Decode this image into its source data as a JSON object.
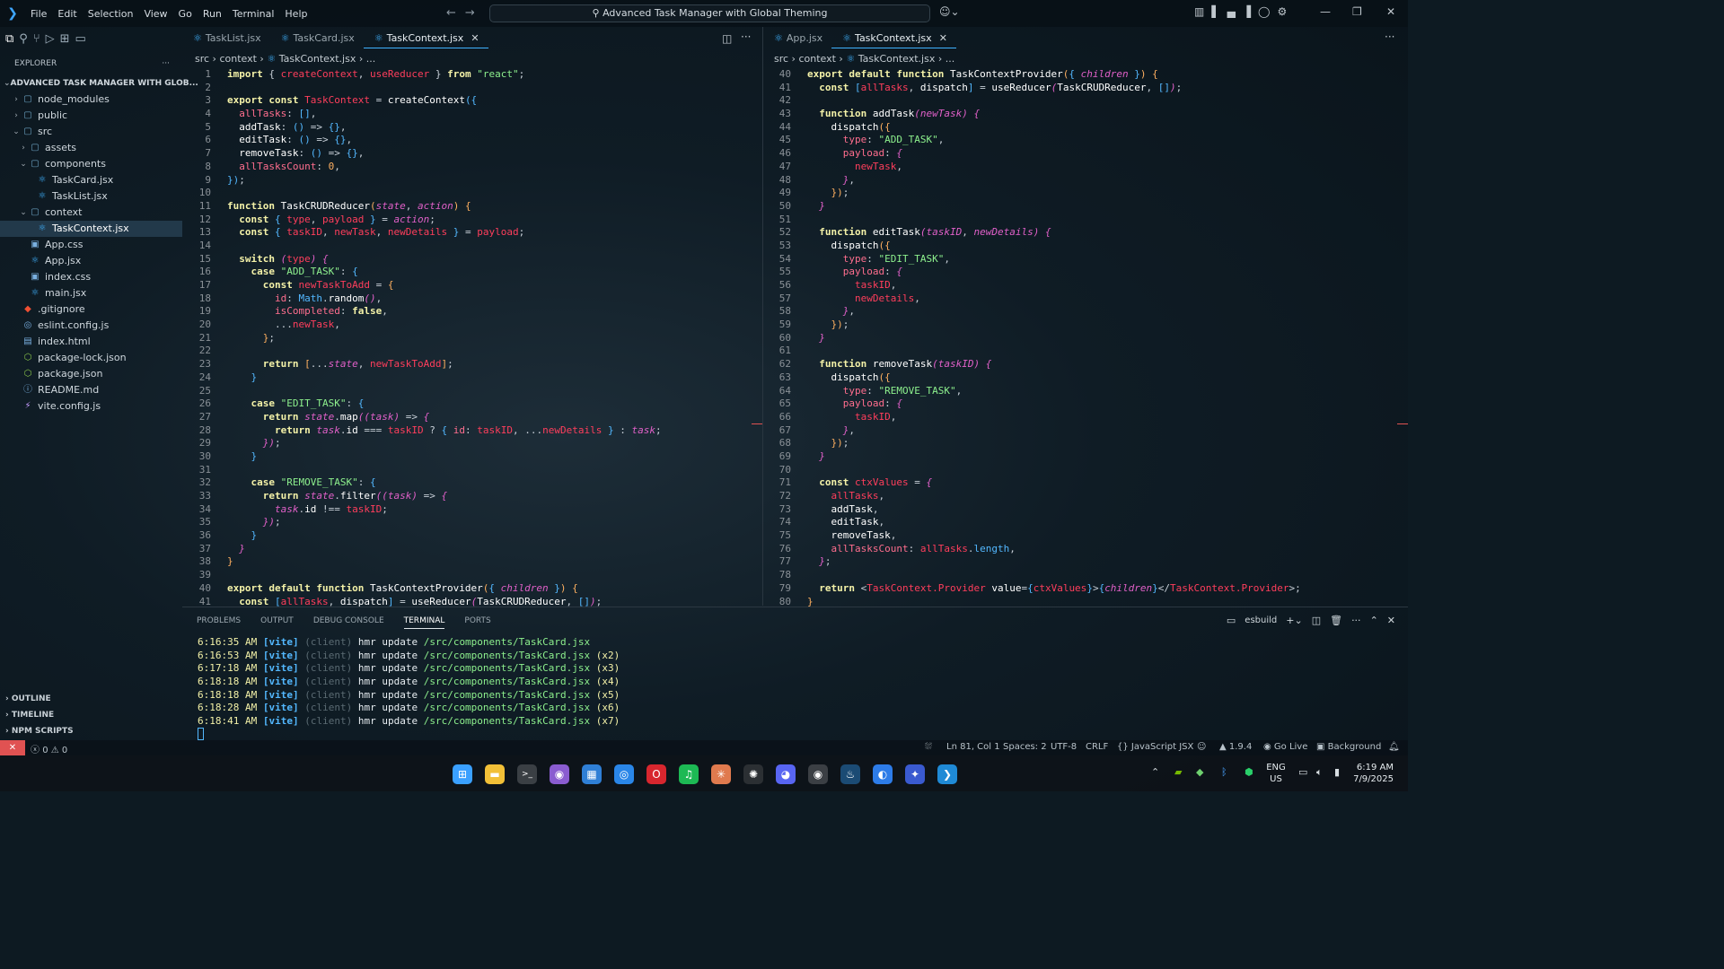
{
  "menu": [
    "File",
    "Edit",
    "Selection",
    "View",
    "Go",
    "Run",
    "Terminal",
    "Help"
  ],
  "search_text": "Advanced Task Manager with Global Theming",
  "explorer": {
    "header": "EXPLORER",
    "more": "···",
    "root": "ADVANCED TASK MANAGER WITH GLOB...",
    "items": [
      {
        "label": "node_modules",
        "indent": 1,
        "chev": "›",
        "icon": "▢"
      },
      {
        "label": "public",
        "indent": 1,
        "chev": "›",
        "icon": "▢"
      },
      {
        "label": "src",
        "indent": 1,
        "chev": "⌄",
        "icon": "▢"
      },
      {
        "label": "assets",
        "indent": 2,
        "chev": "›",
        "icon": "▢"
      },
      {
        "label": "components",
        "indent": 2,
        "chev": "⌄",
        "icon": "▢"
      },
      {
        "label": "TaskCard.jsx",
        "indent": 3,
        "chev": "",
        "icon": "⚛"
      },
      {
        "label": "TaskList.jsx",
        "indent": 3,
        "chev": "",
        "icon": "⚛"
      },
      {
        "label": "context",
        "indent": 2,
        "chev": "⌄",
        "icon": "▢"
      },
      {
        "label": "TaskContext.jsx",
        "indent": 3,
        "chev": "",
        "icon": "⚛"
      },
      {
        "label": "App.css",
        "indent": 2,
        "chev": "",
        "icon": "▣"
      },
      {
        "label": "App.jsx",
        "indent": 2,
        "chev": "",
        "icon": "⚛"
      },
      {
        "label": "index.css",
        "indent": 2,
        "chev": "",
        "icon": "▣"
      },
      {
        "label": "main.jsx",
        "indent": 2,
        "chev": "",
        "icon": "⚛"
      },
      {
        "label": ".gitignore",
        "indent": 1,
        "chev": "",
        "icon": "◆"
      },
      {
        "label": "eslint.config.js",
        "indent": 1,
        "chev": "",
        "icon": "◎"
      },
      {
        "label": "index.html",
        "indent": 1,
        "chev": "",
        "icon": "▤"
      },
      {
        "label": "package-lock.json",
        "indent": 1,
        "chev": "",
        "icon": "⬡"
      },
      {
        "label": "package.json",
        "indent": 1,
        "chev": "",
        "icon": "⬡"
      },
      {
        "label": "README.md",
        "indent": 1,
        "chev": "",
        "icon": "ⓘ"
      },
      {
        "label": "vite.config.js",
        "indent": 1,
        "chev": "",
        "icon": "⚡"
      }
    ],
    "sections": [
      "OUTLINE",
      "TIMELINE",
      "NPM SCRIPTS"
    ]
  },
  "left_group": {
    "tabs": [
      {
        "label": "TaskList.jsx",
        "active": false
      },
      {
        "label": "TaskCard.jsx",
        "active": false
      },
      {
        "label": "TaskContext.jsx",
        "active": true
      }
    ],
    "breadcrumb": [
      "src",
      "context",
      "TaskContext.jsx",
      "..."
    ],
    "lines": [
      {
        "n": 1,
        "h": "<span class='k'>import</span> { <span class='v'>createContext</span>, <span class='v'>useReducer</span> } <span class='k'>from</span> <span class='s'>\"react\"</span>;"
      },
      {
        "n": 2,
        "h": ""
      },
      {
        "n": 3,
        "h": "<span class='k'>export const</span> <span class='v'>TaskContext</span> = <span class='f'>createContext</span><span class='t'>({</span>"
      },
      {
        "n": 4,
        "h": "  <span class='pr'>allTasks</span>: <span class='t'>[]</span>,"
      },
      {
        "n": 5,
        "h": "  <span class='f'>addTask</span>: <span class='t'>()</span> => <span class='t'>{}</span>,"
      },
      {
        "n": 6,
        "h": "  <span class='f'>editTask</span>: <span class='t'>()</span> => <span class='t'>{}</span>,"
      },
      {
        "n": 7,
        "h": "  <span class='f'>removeTask</span>: <span class='t'>()</span> => <span class='t'>{}</span>,"
      },
      {
        "n": 8,
        "h": "  <span class='pr'>allTasksCount</span>: <span class='n'>0</span>,"
      },
      {
        "n": 9,
        "h": "<span class='t'>})</span>;"
      },
      {
        "n": 10,
        "h": ""
      },
      {
        "n": 11,
        "h": "<span class='k'>function</span> <span class='f'>TaskCRUDReducer</span><span class='n'>(</span><span class='p'>state</span>, <span class='p'>action</span><span class='n'>)</span> <span class='n'>{</span>"
      },
      {
        "n": 12,
        "h": "  <span class='k'>const</span> <span class='t'>{</span> <span class='v'>type</span>, <span class='v'>payload</span> <span class='t'>}</span> = <span class='p'>action</span>;"
      },
      {
        "n": 13,
        "h": "  <span class='k'>const</span> <span class='t'>{</span> <span class='v'>taskID</span>, <span class='v'>newTask</span>, <span class='v'>newDetails</span> <span class='t'>}</span> = <span class='v'>payload</span>;"
      },
      {
        "n": 14,
        "h": ""
      },
      {
        "n": 15,
        "h": "  <span class='k'>switch</span> <span class='p'>(</span><span class='v'>type</span><span class='p'>)</span> <span class='p'>{</span>"
      },
      {
        "n": 16,
        "h": "    <span class='k'>case</span> <span class='s'>\"ADD_TASK\"</span>: <span class='t'>{</span>"
      },
      {
        "n": 17,
        "h": "      <span class='k'>const</span> <span class='v'>newTaskToAdd</span> = <span class='n'>{</span>"
      },
      {
        "n": 18,
        "h": "        <span class='pr'>id</span>: <span class='t'>Math</span>.<span class='f'>random</span><span class='p'>()</span>,"
      },
      {
        "n": 19,
        "h": "        <span class='pr'>isCompleted</span>: <span class='k'>false</span>,"
      },
      {
        "n": 20,
        "h": "        ...<span class='v'>newTask</span>,"
      },
      {
        "n": 21,
        "h": "      <span class='n'>}</span>;"
      },
      {
        "n": 22,
        "h": ""
      },
      {
        "n": 23,
        "h": "      <span class='k'>return</span> <span class='n'>[</span>...<span class='p'>state</span>, <span class='v'>newTaskToAdd</span><span class='n'>]</span>;"
      },
      {
        "n": 24,
        "h": "    <span class='t'>}</span>"
      },
      {
        "n": 25,
        "h": ""
      },
      {
        "n": 26,
        "h": "    <span class='k'>case</span> <span class='s'>\"EDIT_TASK\"</span>: <span class='t'>{</span>"
      },
      {
        "n": 27,
        "h": "      <span class='k'>return</span> <span class='p'>state</span>.<span class='f'>map</span><span class='p'>((</span><span class='p'>task</span><span class='p'>)</span> => <span class='p'>{</span>"
      },
      {
        "n": 28,
        "h": "        <span class='k'>return</span> <span class='p'>task</span>.<span class='f'>id</span> === <span class='v'>taskID</span> ? <span class='t'>{</span> <span class='pr'>id</span>: <span class='v'>taskID</span>, ...<span class='v'>newDetails</span> <span class='t'>}</span> : <span class='p'>task</span>;"
      },
      {
        "n": 29,
        "h": "      <span class='p'>})</span>;"
      },
      {
        "n": 30,
        "h": "    <span class='t'>}</span>"
      },
      {
        "n": 31,
        "h": ""
      },
      {
        "n": 32,
        "h": "    <span class='k'>case</span> <span class='s'>\"REMOVE_TASK\"</span>: <span class='t'>{</span>"
      },
      {
        "n": 33,
        "h": "      <span class='k'>return</span> <span class='p'>state</span>.<span class='f'>filter</span><span class='p'>((</span><span class='p'>task</span><span class='p'>)</span> => <span class='p'>{</span>"
      },
      {
        "n": 34,
        "h": "        <span class='p'>task</span>.<span class='f'>id</span> !== <span class='v'>taskID</span>;"
      },
      {
        "n": 35,
        "h": "      <span class='p'>})</span>;"
      },
      {
        "n": 36,
        "h": "    <span class='t'>}</span>"
      },
      {
        "n": 37,
        "h": "  <span class='p'>}</span>"
      },
      {
        "n": 38,
        "h": "<span class='n'>}</span>"
      },
      {
        "n": 39,
        "h": ""
      },
      {
        "n": 40,
        "h": "<span class='k'>export default function</span> <span class='f'>TaskContextProvider</span><span class='n'>(</span><span class='t'>{</span> <span class='p'>children</span> <span class='t'>}</span><span class='n'>)</span> <span class='n'>{</span>"
      },
      {
        "n": 41,
        "h": "  <span class='k'>const</span> <span class='t'>[</span><span class='v'>allTasks</span>, <span class='f'>dispatch</span><span class='t'>]</span> = <span class='f'>useReducer</span><span class='p'>(</span><span class='f'>TaskCRUDReducer</span>, <span class='t'>[]</span><span class='p'>)</span>;"
      }
    ]
  },
  "right_group": {
    "tabs": [
      {
        "label": "App.jsx",
        "active": false
      },
      {
        "label": "TaskContext.jsx",
        "active": true
      }
    ],
    "breadcrumb": [
      "src",
      "context",
      "TaskContext.jsx",
      "..."
    ],
    "lines": [
      {
        "n": 40,
        "h": "<span class='k'>export default function</span> <span class='f'>TaskContextProvider</span><span class='n'>(</span><span class='t'>{</span> <span class='p'>children</span> <span class='t'>}</span><span class='n'>)</span> <span class='n'>{</span>"
      },
      {
        "n": 41,
        "h": "  <span class='k'>const</span> <span class='t'>[</span><span class='v'>allTasks</span>, <span class='f'>dispatch</span><span class='t'>]</span> = <span class='f'>useReducer</span><span class='p'>(</span><span class='f'>TaskCRUDReducer</span>, <span class='t'>[]</span><span class='p'>)</span>;"
      },
      {
        "n": 42,
        "h": ""
      },
      {
        "n": 43,
        "h": "  <span class='k'>function</span> <span class='f'>addTask</span><span class='p'>(</span><span class='p'>newTask</span><span class='p'>)</span> <span class='p'>{</span>"
      },
      {
        "n": 44,
        "h": "    <span class='f'>dispatch</span><span class='n'>({</span>"
      },
      {
        "n": 45,
        "h": "      <span class='pr'>type</span>: <span class='s'>\"ADD_TASK\"</span>,"
      },
      {
        "n": 46,
        "h": "      <span class='pr'>payload</span>: <span class='p'>{</span>"
      },
      {
        "n": 47,
        "h": "        <span class='v'>newTask</span>,"
      },
      {
        "n": 48,
        "h": "      <span class='p'>}</span>,"
      },
      {
        "n": 49,
        "h": "    <span class='n'>})</span>;"
      },
      {
        "n": 50,
        "h": "  <span class='p'>}</span>"
      },
      {
        "n": 51,
        "h": ""
      },
      {
        "n": 52,
        "h": "  <span class='k'>function</span> <span class='f'>editTask</span><span class='p'>(</span><span class='p'>taskID</span>, <span class='p'>newDetails</span><span class='p'>)</span> <span class='p'>{</span>"
      },
      {
        "n": 53,
        "h": "    <span class='f'>dispatch</span><span class='n'>({</span>"
      },
      {
        "n": 54,
        "h": "      <span class='pr'>type</span>: <span class='s'>\"EDIT_TASK\"</span>,"
      },
      {
        "n": 55,
        "h": "      <span class='pr'>payload</span>: <span class='p'>{</span>"
      },
      {
        "n": 56,
        "h": "        <span class='v'>taskID</span>,"
      },
      {
        "n": 57,
        "h": "        <span class='v'>newDetails</span>,"
      },
      {
        "n": 58,
        "h": "      <span class='p'>}</span>,"
      },
      {
        "n": 59,
        "h": "    <span class='n'>})</span>;"
      },
      {
        "n": 60,
        "h": "  <span class='p'>}</span>"
      },
      {
        "n": 61,
        "h": ""
      },
      {
        "n": 62,
        "h": "  <span class='k'>function</span> <span class='f'>removeTask</span><span class='p'>(</span><span class='p'>taskID</span><span class='p'>)</span> <span class='p'>{</span>"
      },
      {
        "n": 63,
        "h": "    <span class='f'>dispatch</span><span class='n'>({</span>"
      },
      {
        "n": 64,
        "h": "      <span class='pr'>type</span>: <span class='s'>\"REMOVE_TASK\"</span>,"
      },
      {
        "n": 65,
        "h": "      <span class='pr'>payload</span>: <span class='p'>{</span>"
      },
      {
        "n": 66,
        "h": "        <span class='v'>taskID</span>,"
      },
      {
        "n": 67,
        "h": "      <span class='p'>}</span>,"
      },
      {
        "n": 68,
        "h": "    <span class='n'>})</span>;"
      },
      {
        "n": 69,
        "h": "  <span class='p'>}</span>"
      },
      {
        "n": 70,
        "h": ""
      },
      {
        "n": 71,
        "h": "  <span class='k'>const</span> <span class='v'>ctxValues</span> = <span class='p'>{</span>"
      },
      {
        "n": 72,
        "h": "    <span class='v'>allTasks</span>,"
      },
      {
        "n": 73,
        "h": "    <span class='f'>addTask</span>,"
      },
      {
        "n": 74,
        "h": "    <span class='f'>editTask</span>,"
      },
      {
        "n": 75,
        "h": "    <span class='f'>removeTask</span>,"
      },
      {
        "n": 76,
        "h": "    <span class='pr'>allTasksCount</span>: <span class='v'>allTasks</span>.<span class='t'>length</span>,"
      },
      {
        "n": 77,
        "h": "  <span class='p'>}</span>;"
      },
      {
        "n": 78,
        "h": ""
      },
      {
        "n": 79,
        "h": "  <span class='k'>return</span> &lt;<span class='v'>TaskContext.Provider</span> <span class='f'>value</span>=<span class='t'>{</span><span class='v'>ctxValues</span><span class='t'>}</span>&gt;<span class='t'>{</span><span class='p'>children</span><span class='t'>}</span>&lt;/<span class='v'>TaskContext.Provider</span>&gt;;"
      },
      {
        "n": 80,
        "h": "<span class='n'>}</span>"
      }
    ]
  },
  "panel": {
    "tabs": [
      "PROBLEMS",
      "OUTPUT",
      "DEBUG CONSOLE",
      "TERMINAL",
      "PORTS"
    ],
    "active_tab": "TERMINAL",
    "terminal_name": "esbuild",
    "terminal_lines": [
      {
        "time": "6:16:35 AM",
        "tag": "[vite]",
        "client": "(client)",
        "msg": "hmr update",
        "path": "/src/components/TaskCard.jsx",
        "count": ""
      },
      {
        "time": "6:16:53 AM",
        "tag": "[vite]",
        "client": "(client)",
        "msg": "hmr update",
        "path": "/src/components/TaskCard.jsx",
        "count": "(x2)"
      },
      {
        "time": "6:17:18 AM",
        "tag": "[vite]",
        "client": "(client)",
        "msg": "hmr update",
        "path": "/src/components/TaskCard.jsx",
        "count": "(x3)"
      },
      {
        "time": "6:18:18 AM",
        "tag": "[vite]",
        "client": "(client)",
        "msg": "hmr update",
        "path": "/src/components/TaskCard.jsx",
        "count": "(x4)"
      },
      {
        "time": "6:18:18 AM",
        "tag": "[vite]",
        "client": "(client)",
        "msg": "hmr update",
        "path": "/src/components/TaskCard.jsx",
        "count": "(x5)"
      },
      {
        "time": "6:18:28 AM",
        "tag": "[vite]",
        "client": "(client)",
        "msg": "hmr update",
        "path": "/src/components/TaskCard.jsx",
        "count": "(x6)"
      },
      {
        "time": "6:18:41 AM",
        "tag": "[vite]",
        "client": "(client)",
        "msg": "hmr update",
        "path": "/src/components/TaskCard.jsx",
        "count": "(x7)"
      }
    ]
  },
  "status": {
    "errors": "0",
    "warnings": "0",
    "position": "Ln 81, Col 1",
    "spaces": "Spaces: 2",
    "encoding": "UTF-8",
    "eol": "CRLF",
    "language": "JavaScript JSX",
    "version": "1.9.4",
    "golive": "Go Live",
    "background": "Background"
  },
  "taskbar": {
    "lang1": "ENG",
    "lang2": "US",
    "time": "6:19 AM",
    "date": "7/9/2025",
    "apps": [
      {
        "name": "windows-start-icon",
        "glyph": "⊞",
        "color": "#3aa0ff"
      },
      {
        "name": "file-explorer-icon",
        "glyph": "▬",
        "color": "#f2c037"
      },
      {
        "name": "terminal-icon",
        "glyph": ">_",
        "color": "#3a3f44"
      },
      {
        "name": "github-icon",
        "glyph": "◉",
        "color": "#8a5cd0"
      },
      {
        "name": "photos-icon",
        "glyph": "▦",
        "color": "#2f7fd6"
      },
      {
        "name": "chrome-icon",
        "glyph": "◎",
        "color": "#2a86e8"
      },
      {
        "name": "opera-icon",
        "glyph": "O",
        "color": "#d8262e"
      },
      {
        "name": "spotify-icon",
        "glyph": "♫",
        "color": "#1db954"
      },
      {
        "name": "claude-icon",
        "glyph": "✳",
        "color": "#e07a4e"
      },
      {
        "name": "chatgpt-icon",
        "glyph": "✺",
        "color": "#2b2f33"
      },
      {
        "name": "discord-icon",
        "glyph": "◕",
        "color": "#5865f2"
      },
      {
        "name": "obs-icon",
        "glyph": "◉",
        "color": "#3b3f44"
      },
      {
        "name": "steam-icon",
        "glyph": "♨",
        "color": "#1b4b74"
      },
      {
        "name": "firefox-icon",
        "glyph": "◐",
        "color": "#2d7ce8"
      },
      {
        "name": "bluestacks-icon",
        "glyph": "✦",
        "color": "#3a5ad0"
      },
      {
        "name": "vscode-icon",
        "glyph": "❯",
        "color": "#1f8ad6"
      }
    ]
  }
}
